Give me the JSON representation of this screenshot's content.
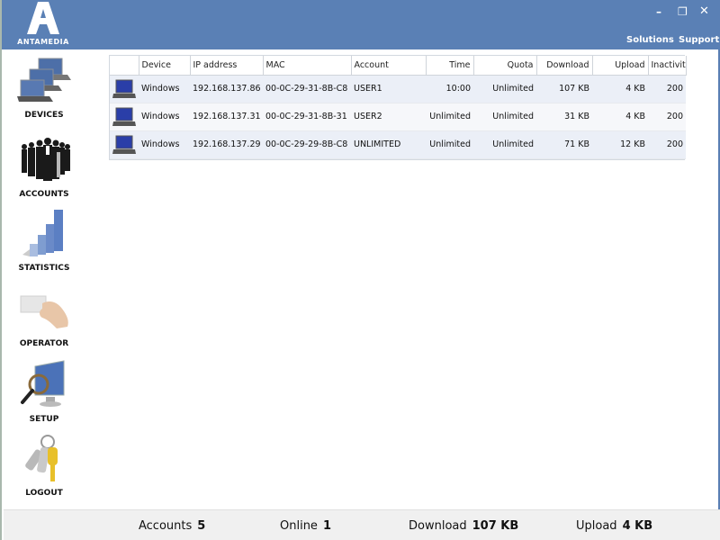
{
  "app": {
    "brand": "ANTAMEDIA",
    "window_controls": {
      "minimize": "–",
      "restore": "❐",
      "close": "✕"
    },
    "top_links": [
      "Solutions",
      "Support"
    ]
  },
  "sidebar": {
    "items": [
      {
        "label": "DEVICES",
        "icon": "laptops-icon"
      },
      {
        "label": "ACCOUNTS",
        "icon": "people-icon"
      },
      {
        "label": "STATISTICS",
        "icon": "bar-chart-icon"
      },
      {
        "label": "OPERATOR",
        "icon": "hand-card-icon"
      },
      {
        "label": "SETUP",
        "icon": "monitor-magnifier-icon"
      },
      {
        "label": "LOGOUT",
        "icon": "keys-icon"
      }
    ]
  },
  "devices_table": {
    "columns": [
      "",
      "Device",
      "IP address",
      "MAC",
      "Account",
      "Time",
      "Quota",
      "Download",
      "Upload",
      "Inactivity"
    ],
    "rows": [
      {
        "device": "Windows",
        "ip": "192.168.137.86",
        "mac": "00-0C-29-31-8B-C8",
        "account": "USER1",
        "time": "10:00",
        "quota": "Unlimited",
        "download": "107 KB",
        "upload": "4 KB",
        "inactivity": "200"
      },
      {
        "device": "Windows",
        "ip": "192.168.137.31",
        "mac": "00-0C-29-31-8B-31",
        "account": "USER2",
        "time": "Unlimited",
        "quota": "Unlimited",
        "download": "31 KB",
        "upload": "4 KB",
        "inactivity": "200"
      },
      {
        "device": "Windows",
        "ip": "192.168.137.29",
        "mac": "00-0C-29-29-8B-C8",
        "account": "UNLIMITED",
        "time": "Unlimited",
        "quota": "Unlimited",
        "download": "71 KB",
        "upload": "12 KB",
        "inactivity": "200"
      }
    ]
  },
  "statusbar": {
    "accounts_label": "Accounts",
    "accounts_value": "5",
    "online_label": "Online",
    "online_value": "1",
    "download_label": "Download",
    "download_value": "107 KB",
    "upload_label": "Upload",
    "upload_value": "4 KB"
  },
  "colors": {
    "titlebar": "#5a80b5",
    "row_odd": "#ebeff7",
    "row_even": "#f6f7fa",
    "statusbar": "#f0f0f0"
  }
}
